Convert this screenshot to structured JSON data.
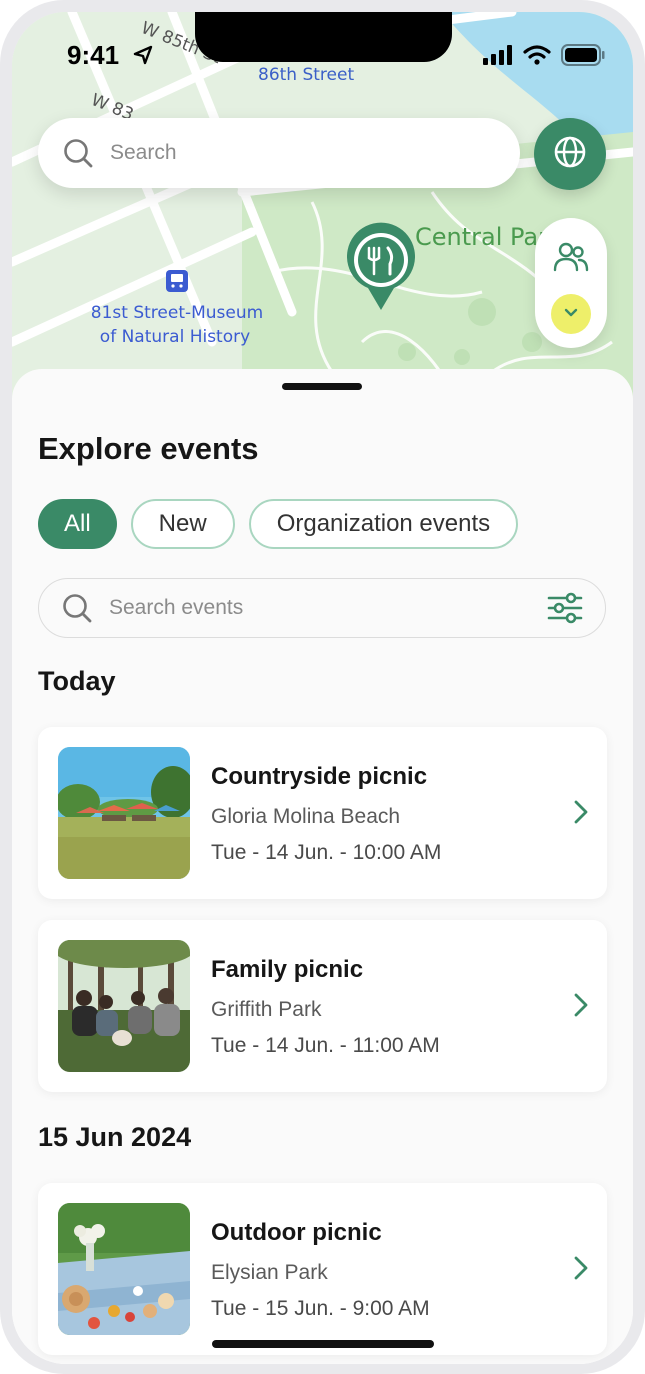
{
  "status_bar": {
    "time": "9:41"
  },
  "map": {
    "street_labels": [
      "W 85th St",
      "86th Street",
      "W 83"
    ],
    "park_label": "Central Park",
    "poi_label_line1": "81st Street-Museum",
    "poi_label_line2": "of Natural History",
    "pin_icon": "fork-knife-icon"
  },
  "search": {
    "placeholder": "Search"
  },
  "sheet": {
    "title": "Explore events",
    "filters": [
      "All",
      "New",
      "Organization events"
    ],
    "search_placeholder": "Search events"
  },
  "sections": [
    {
      "heading": "Today",
      "events": [
        {
          "title": "Countryside picnic",
          "location": "Gloria Molina Beach",
          "datetime": "Tue - 14 Jun. - 10:00 AM"
        },
        {
          "title": "Family picnic",
          "location": "Griffith Park",
          "datetime": "Tue - 14 Jun. - 11:00 AM"
        }
      ]
    },
    {
      "heading": "15 Jun 2024",
      "events": [
        {
          "title": "Outdoor picnic",
          "location": "Elysian Park",
          "datetime": "Tue - 15 Jun. - 9:00 AM"
        }
      ]
    }
  ],
  "colors": {
    "accent": "#3a8a67",
    "chip_border": "#a9d6c0",
    "highlight": "#eeef6a"
  }
}
